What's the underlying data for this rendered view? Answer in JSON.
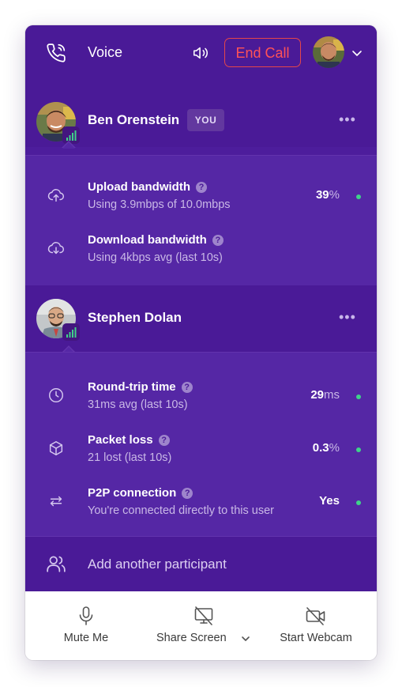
{
  "header": {
    "title": "Voice",
    "end_call_label": "End Call"
  },
  "participants": [
    {
      "name": "Ben Orenstein",
      "badge": "YOU"
    },
    {
      "name": "Stephen Dolan",
      "badge": ""
    }
  ],
  "ben_stats": [
    {
      "title": "Upload bandwidth",
      "subtitle": "Using 3.9mbps of 10.0mbps",
      "value": "39",
      "unit": "%",
      "icon": "upload-cloud-icon"
    },
    {
      "title": "Download bandwidth",
      "subtitle": "Using 4kbps avg (last 10s)",
      "value": "",
      "unit": "",
      "icon": "download-cloud-icon"
    }
  ],
  "stephen_stats": [
    {
      "title": "Round-trip time",
      "subtitle": "31ms avg (last 10s)",
      "value": "29",
      "unit": "ms",
      "icon": "clock-icon"
    },
    {
      "title": "Packet loss",
      "subtitle": "21 lost (last 10s)",
      "value": "0.3",
      "unit": "%",
      "icon": "package-icon"
    },
    {
      "title": "P2P connection",
      "subtitle": "You're connected directly to this user",
      "value": "Yes",
      "unit": "",
      "icon": "arrows-swap-icon"
    }
  ],
  "more_label": "•••",
  "help_label": "?",
  "add_participant_label": "Add another participant",
  "footer": {
    "mute_label": "Mute Me",
    "share_label": "Share Screen",
    "webcam_label": "Start Webcam"
  },
  "colors": {
    "panel_purple": "#4d1d9c",
    "stats_purple": "#5527a5",
    "end_call_red": "#ff5257",
    "status_green": "#3fd38a"
  }
}
